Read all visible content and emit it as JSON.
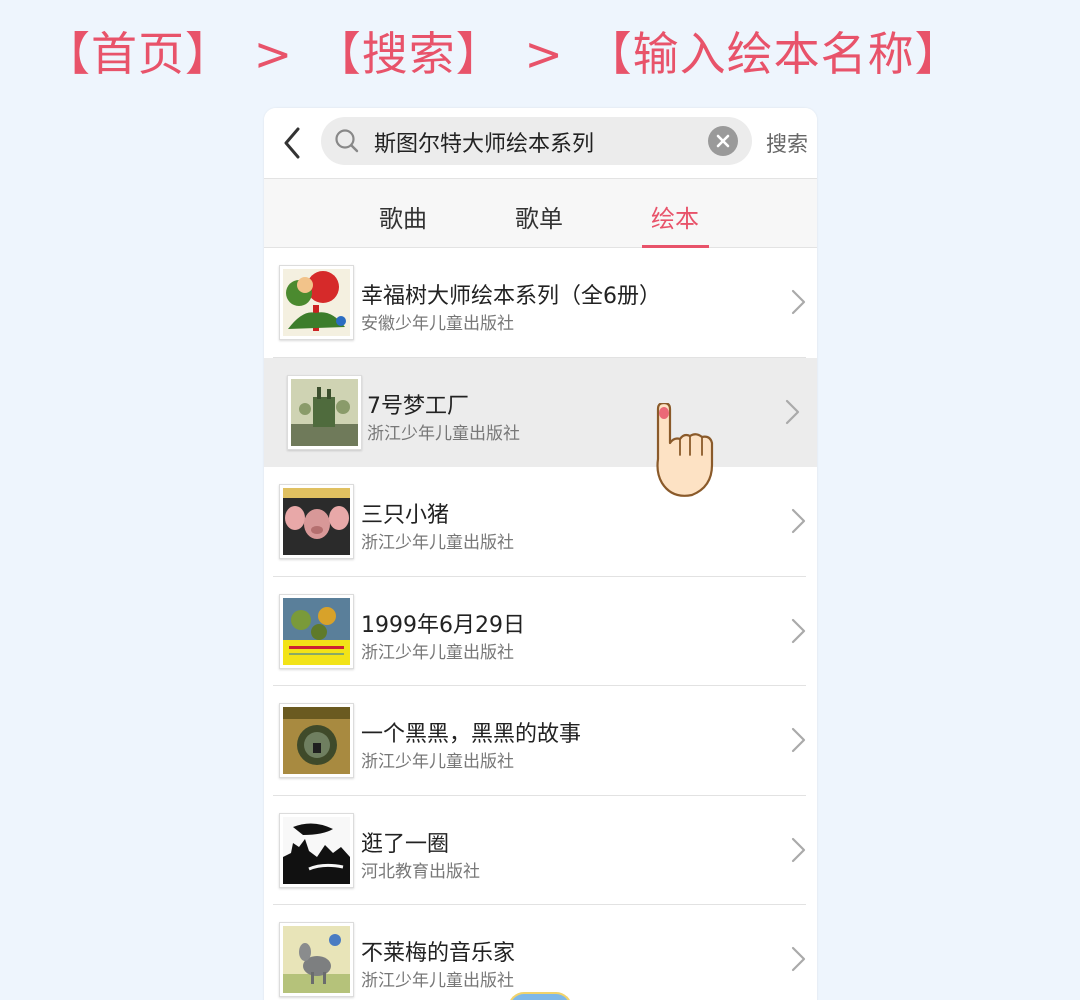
{
  "breadcrumb": {
    "step1": "【首页】",
    "step2": "【搜索】",
    "step3": "【输入绘本名称】",
    "separator": ">"
  },
  "search": {
    "query": "斯图尔特大师绘本系列",
    "button_label": "搜索"
  },
  "tabs": [
    {
      "label": "歌曲",
      "active": false
    },
    {
      "label": "歌单",
      "active": false
    },
    {
      "label": "绘本",
      "active": true
    }
  ],
  "books": [
    {
      "title": "幸福树大师绘本系列（全6册）",
      "publisher": "安徽少年儿童出版社",
      "cover_icon": "book-cover-tree"
    },
    {
      "title": "7号梦工厂",
      "publisher": "浙江少年儿童出版社",
      "cover_icon": "book-cover-dream-factory"
    },
    {
      "title": "三只小猪",
      "publisher": "浙江少年儿童出版社",
      "cover_icon": "book-cover-pig"
    },
    {
      "title": "1999年6月29日",
      "publisher": "浙江少年儿童出版社",
      "cover_icon": "book-cover-vegetables"
    },
    {
      "title": "一个黑黑，黑黑的故事",
      "publisher": "浙江少年儿童出版社",
      "cover_icon": "book-cover-dark-story"
    },
    {
      "title": "逛了一圈",
      "publisher": "河北教育出版社",
      "cover_icon": "book-cover-silhouette"
    },
    {
      "title": "不莱梅的音乐家",
      "publisher": "浙江少年儿童出版社",
      "cover_icon": "book-cover-donkey"
    }
  ],
  "colors": {
    "accent": "#e8536a",
    "background": "#eef5fd",
    "pressed_row": "#ececec"
  }
}
